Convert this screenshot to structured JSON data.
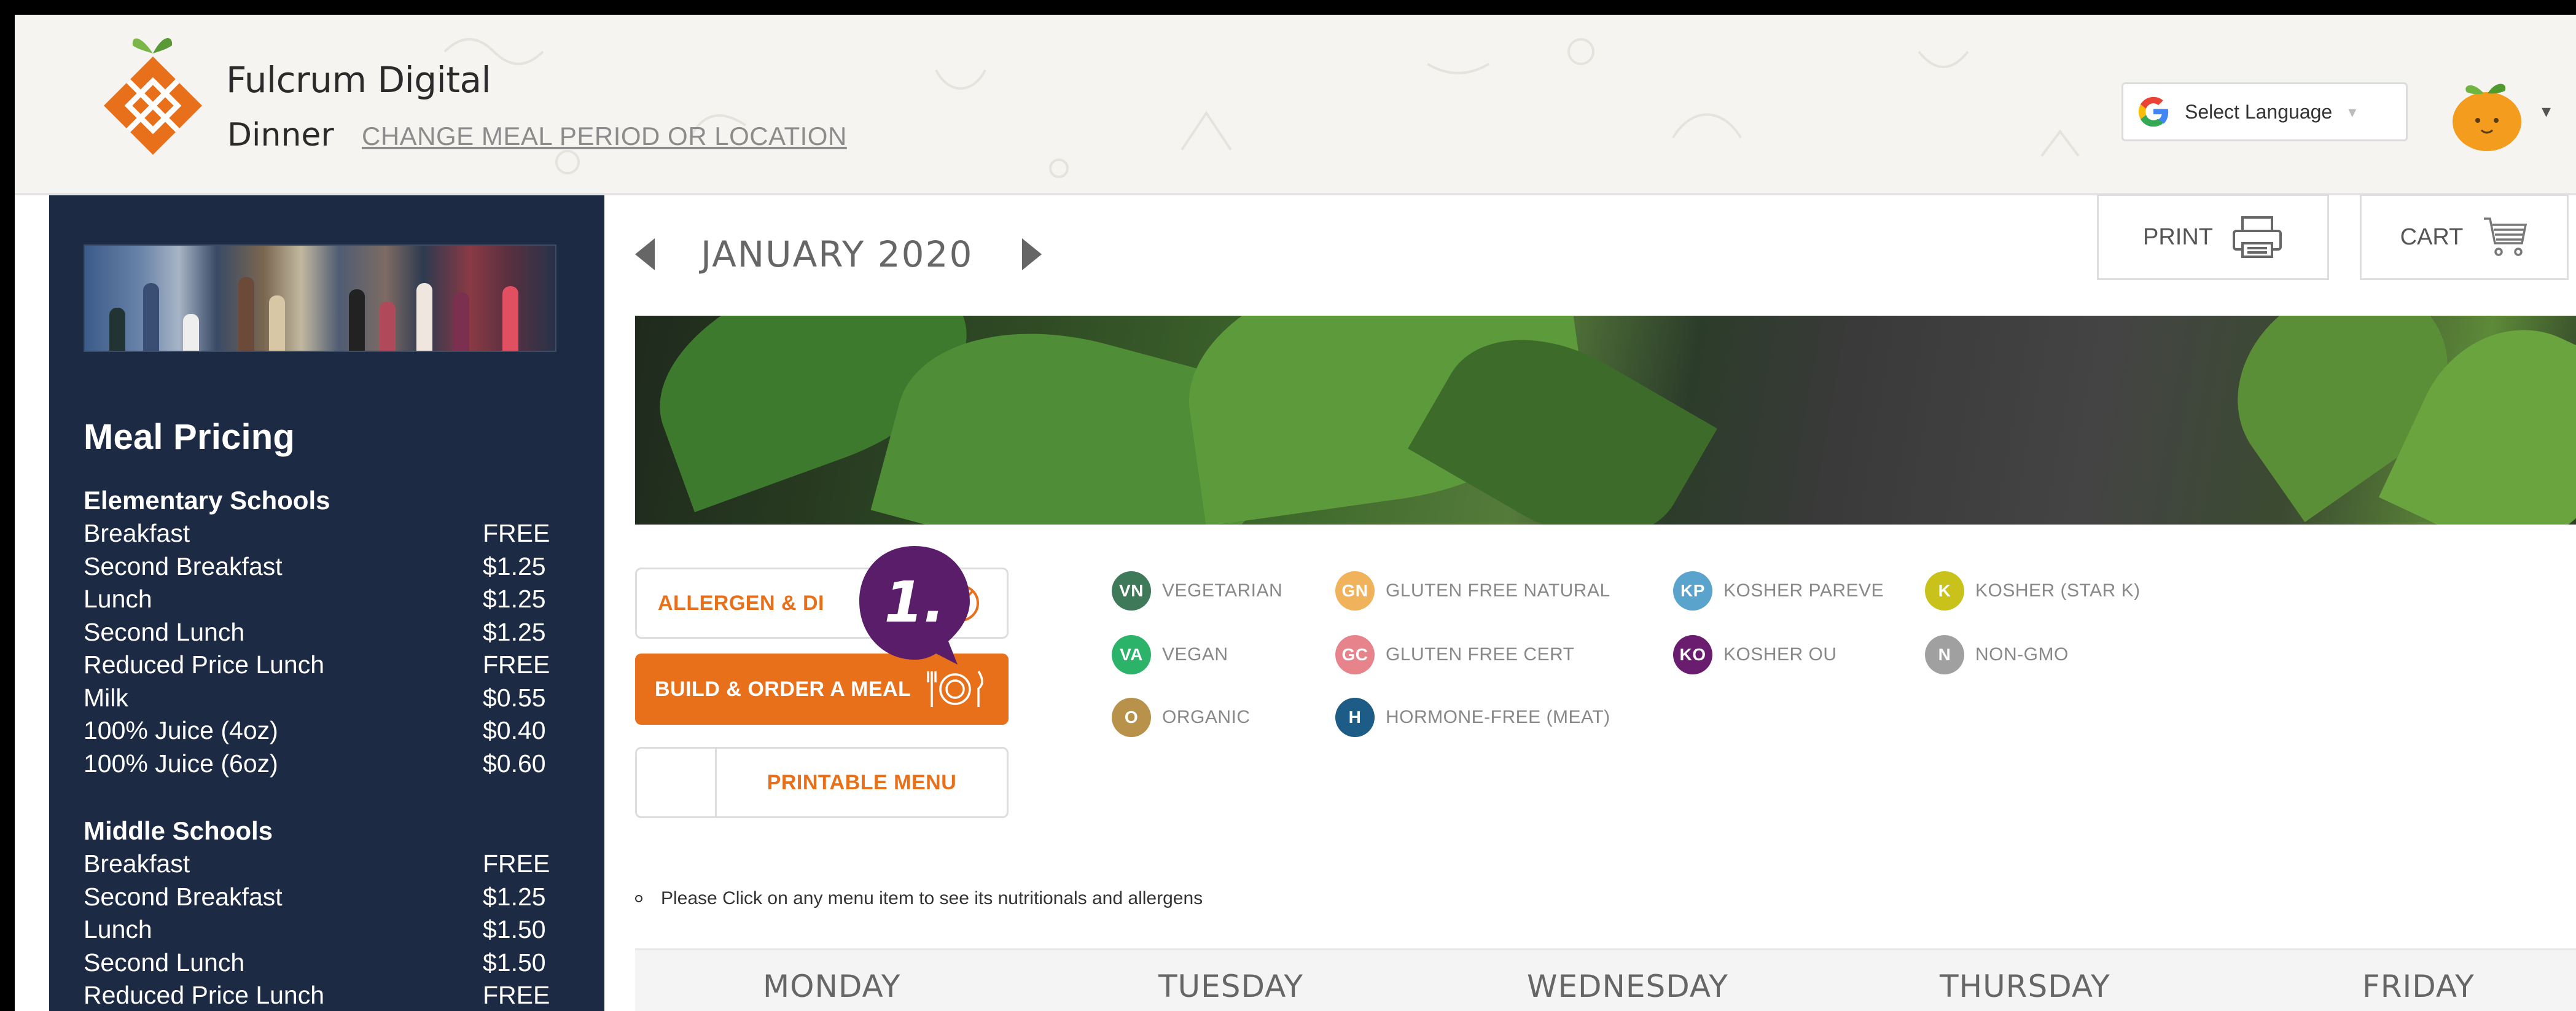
{
  "header": {
    "brand": "Fulcrum Digital",
    "meal_period": "Dinner",
    "change_link": "CHANGE MEAL PERIOD OR LOCATION",
    "language_select": "Select Language"
  },
  "sidebar": {
    "pricing_title": "Meal Pricing",
    "sections": [
      {
        "title": "Elementary Schools",
        "rows": [
          {
            "item": "Breakfast",
            "price": "FREE"
          },
          {
            "item": "Second Breakfast",
            "price": "$1.25"
          },
          {
            "item": "Lunch",
            "price": "$1.25"
          },
          {
            "item": "Second Lunch",
            "price": "$1.25"
          },
          {
            "item": "Reduced Price Lunch",
            "price": "FREE"
          },
          {
            "item": "Milk",
            "price": "$0.55"
          },
          {
            "item": "100% Juice (4oz)",
            "price": "$0.40"
          },
          {
            "item": "100% Juice (6oz)",
            "price": "$0.60"
          }
        ]
      },
      {
        "title": "Middle Schools",
        "rows": [
          {
            "item": "Breakfast",
            "price": "FREE"
          },
          {
            "item": "Second Breakfast",
            "price": "$1.25"
          },
          {
            "item": "Lunch",
            "price": "$1.50"
          },
          {
            "item": "Second Lunch",
            "price": "$1.50"
          },
          {
            "item": "Reduced Price Lunch",
            "price": "FREE"
          }
        ]
      }
    ]
  },
  "main": {
    "month": "JANUARY 2020",
    "print_label": "PRINT",
    "cart_label": "CART",
    "allergen_label": "ALLERGEN & DI",
    "build_label": "BUILD & ORDER A MEAL",
    "printable_label": "PRINTABLE MENU",
    "step_marker": "1.",
    "hint": "Please Click on any menu item to see its nutritionals and allergens",
    "legend": [
      {
        "code": "VN",
        "label": "VEGETARIAN",
        "color": "#3e7a5a"
      },
      {
        "code": "GN",
        "label": "GLUTEN FREE NATURAL",
        "color": "#f0b25a"
      },
      {
        "code": "KP",
        "label": "KOSHER PAREVE",
        "color": "#5aa3cc"
      },
      {
        "code": "K",
        "label": "KOSHER (STAR K)",
        "color": "#c8c21a"
      },
      {
        "code": "VA",
        "label": "VEGAN",
        "color": "#2bb36a"
      },
      {
        "code": "GC",
        "label": "GLUTEN FREE CERT",
        "color": "#e7838a"
      },
      {
        "code": "KO",
        "label": "KOSHER OU",
        "color": "#6a1c6e"
      },
      {
        "code": "N",
        "label": "NON-GMO",
        "color": "#a0a0a0"
      },
      {
        "code": "O",
        "label": "ORGANIC",
        "color": "#b8924a"
      },
      {
        "code": "H",
        "label": "HORMONE-FREE (MEAT)",
        "color": "#1d5c86"
      }
    ],
    "days": [
      "MONDAY",
      "TUESDAY",
      "WEDNESDAY",
      "THURSDAY",
      "FRIDAY"
    ]
  },
  "colors": {
    "accent": "#e8701a",
    "sidebar": "#1c2a44",
    "marker": "#5a1d6a"
  }
}
